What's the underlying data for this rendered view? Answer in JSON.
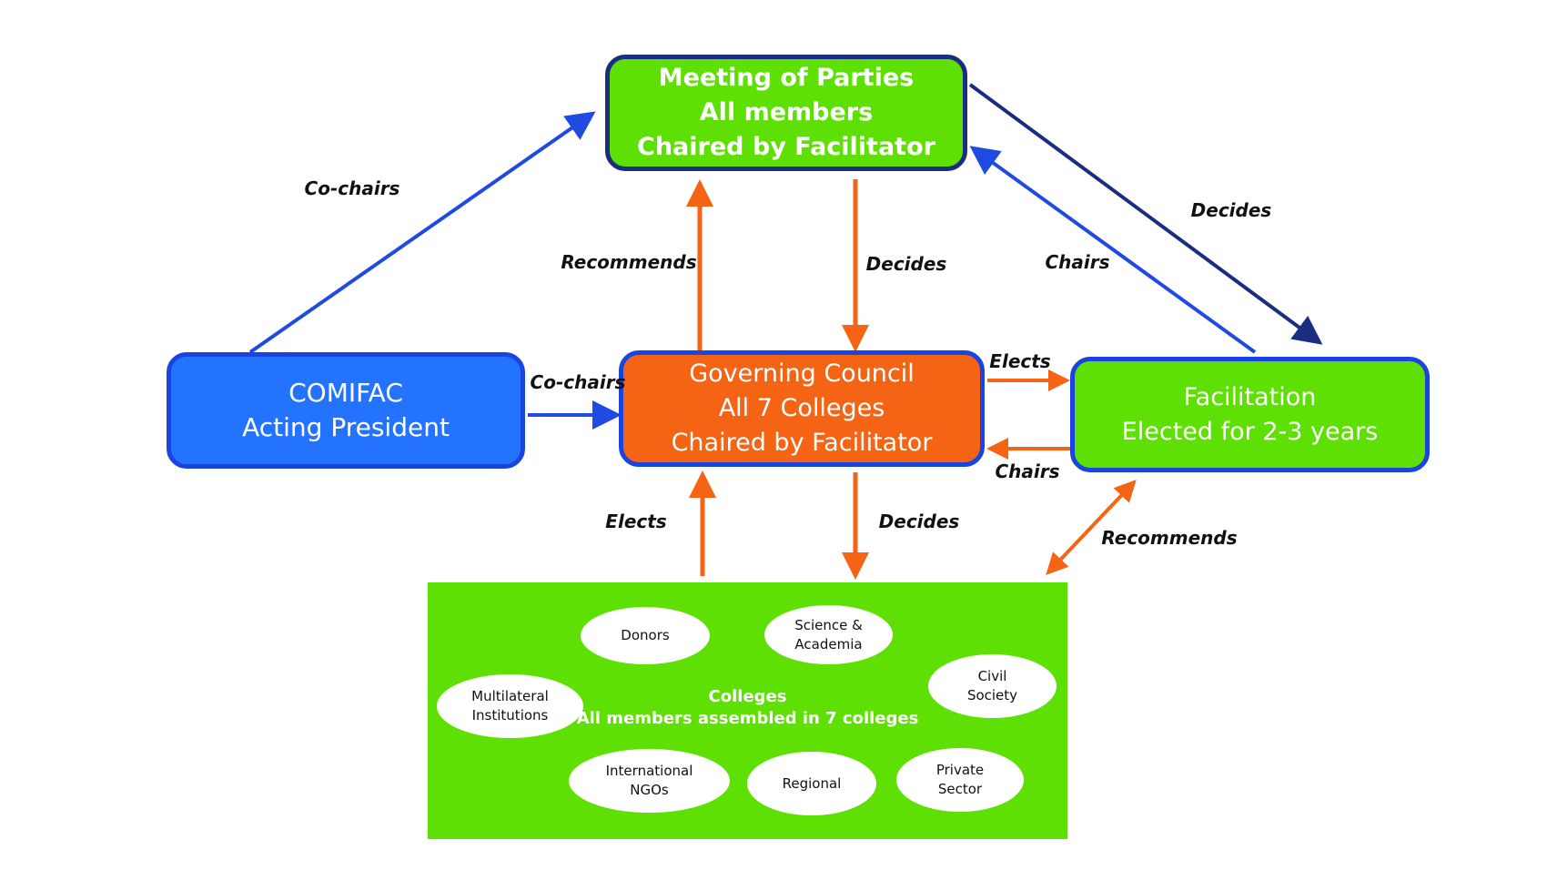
{
  "nodes": {
    "meeting_of_parties": {
      "lines": [
        "Meeting of Parties",
        "All members",
        "Chaired by Facilitator"
      ]
    },
    "comifac": {
      "lines": [
        "COMIFAC",
        "Acting President"
      ]
    },
    "governing_council": {
      "lines": [
        "Governing Council",
        "All 7 Colleges",
        "Chaired by Facilitator"
      ]
    },
    "facilitation": {
      "lines": [
        "Facilitation",
        "Elected for 2-3 years"
      ]
    },
    "colleges": {
      "title": "Colleges",
      "subtitle": "All members assembled in 7 colleges",
      "members": [
        {
          "lines": [
            "Donors"
          ]
        },
        {
          "lines": [
            "Science &",
            "Academia"
          ]
        },
        {
          "lines": [
            "Multilateral",
            "Institutions"
          ]
        },
        {
          "lines": [
            "Civil",
            "Society"
          ]
        },
        {
          "lines": [
            "International",
            "NGOs"
          ]
        },
        {
          "lines": [
            "Regional"
          ]
        },
        {
          "lines": [
            "Private",
            "Sector"
          ]
        }
      ]
    }
  },
  "edges": [
    {
      "from": "COMIFAC",
      "to": "Meeting of Parties",
      "label": "Co-chairs"
    },
    {
      "from": "COMIFAC",
      "to": "Governing Council",
      "label": "Co-chairs"
    },
    {
      "from": "Governing Council",
      "to": "Meeting of Parties",
      "label": "Recommends"
    },
    {
      "from": "Meeting of Parties",
      "to": "Governing Council",
      "label": "Decides"
    },
    {
      "from": "Meeting of Parties",
      "to": "Facilitation",
      "label": "Decides"
    },
    {
      "from": "Facilitation",
      "to": "Meeting of Parties",
      "label": "Chairs"
    },
    {
      "from": "Governing Council",
      "to": "Facilitation",
      "label": "Elects"
    },
    {
      "from": "Facilitation",
      "to": "Governing Council",
      "label": "Chairs"
    },
    {
      "from": "Colleges",
      "to": "Governing Council",
      "label": "Elects"
    },
    {
      "from": "Governing Council",
      "to": "Colleges",
      "label": "Decides"
    },
    {
      "from": "Facilitation",
      "to": "Colleges",
      "label": "Recommends",
      "bidirectional": true
    }
  ],
  "colors": {
    "green": "#5ee004",
    "blue": "#2473ff",
    "orange": "#f46414",
    "navy": "#1a2d80",
    "arrow_blue": "#1f4be0"
  }
}
